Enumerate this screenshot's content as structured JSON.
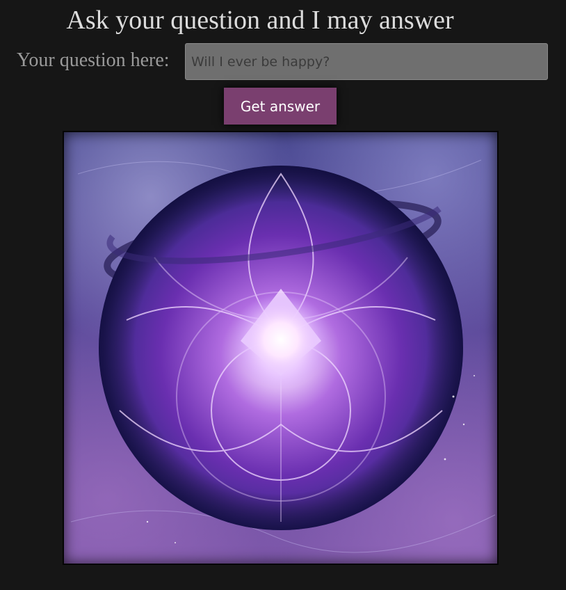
{
  "header": {
    "title": "Ask your question and I may answer"
  },
  "form": {
    "question_label": "Your question here:",
    "question_placeholder": "Will I ever be happy?",
    "question_value": "",
    "submit_label": "Get answer"
  },
  "image": {
    "subject": "magic crystal ball with glowing purple energy",
    "colors": {
      "accent_button": "#7a3f6f",
      "page_background": "#161616"
    }
  }
}
